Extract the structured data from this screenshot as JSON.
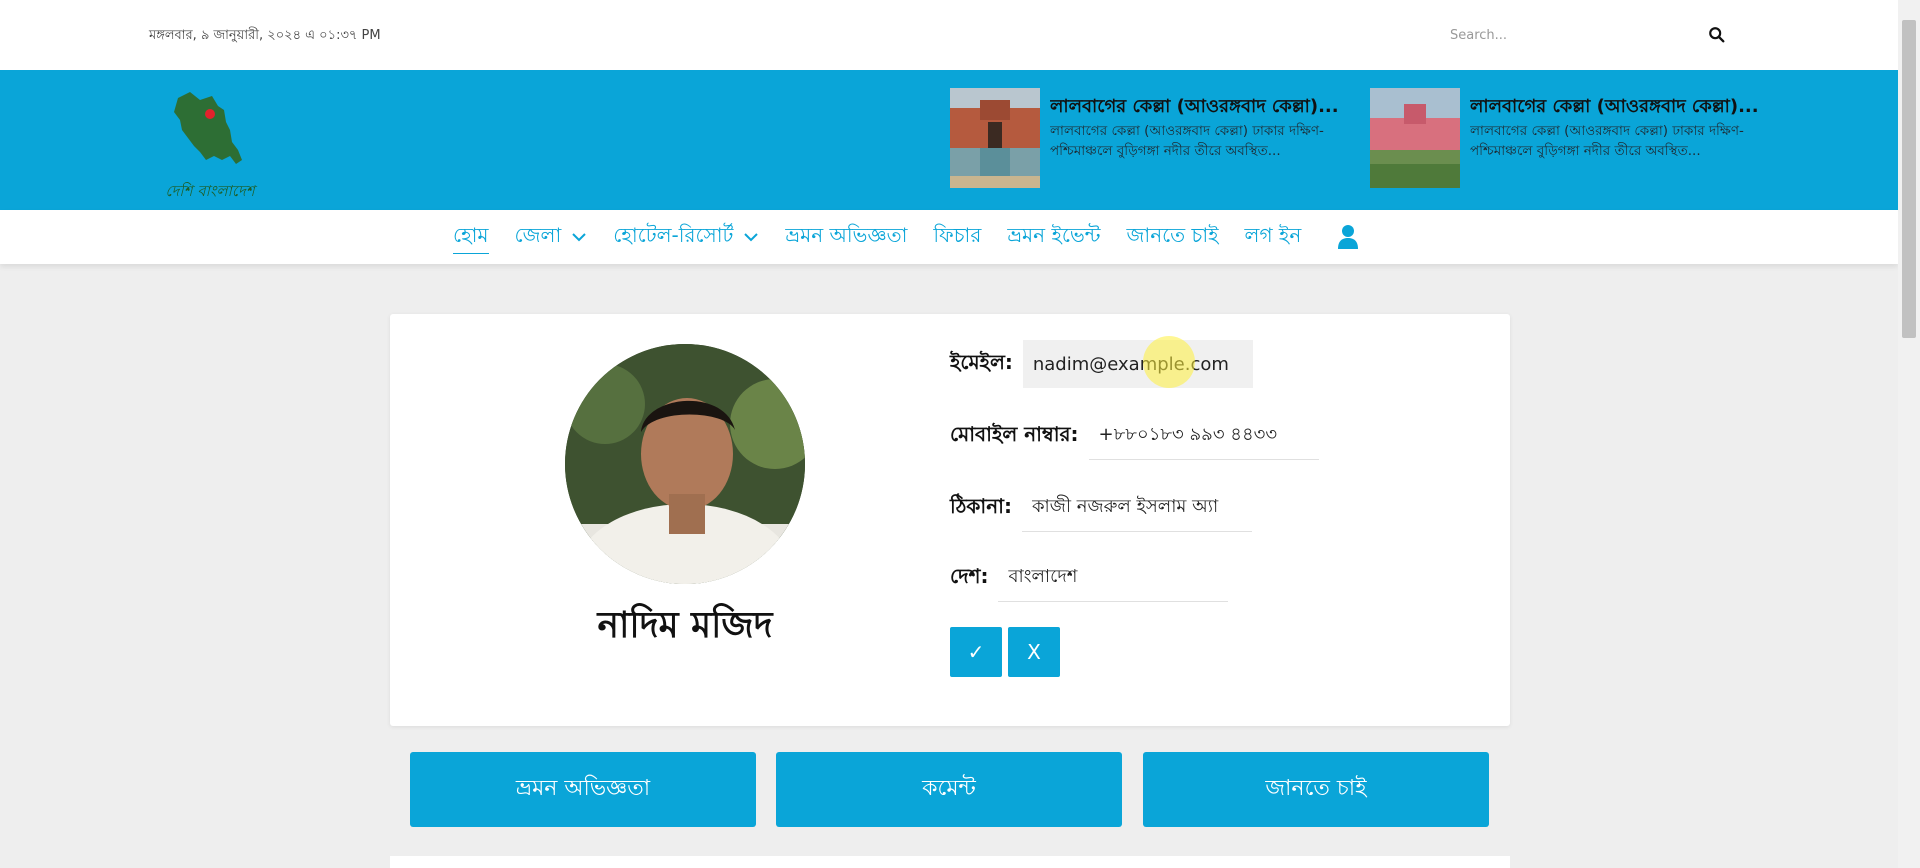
{
  "topbar": {
    "date": "মঙ্গলবার, ৯ জানুয়ারী, ২০২৪ এ ০১:৩৭ PM",
    "search_placeholder": "Search..."
  },
  "logo": {
    "text": "দেশি বাংলাদেশ"
  },
  "news": [
    {
      "title": "লালবাগের কেল্লা (আওরঙ্গবাদ কেল্লা)...",
      "desc": "লালবাগের কেল্লা (আওরঙ্গবাদ কেল্লা) ঢাকার দক্ষিণ-পশ্চিমাঞ্চলে বুড়িগঙ্গা নদীর তীরে অবস্থিত..."
    },
    {
      "title": "লালবাগের কেল্লা (আওরঙ্গবাদ কেল্লা)...",
      "desc": "লালবাগের কেল্লা (আওরঙ্গবাদ কেল্লা) ঢাকার দক্ষিণ-পশ্চিমাঞ্চলে বুড়িগঙ্গা নদীর তীরে অবস্থিত..."
    }
  ],
  "nav": {
    "home": "হোম",
    "district": "জেলা",
    "hotel": "হোটেল-রিসোর্ট",
    "travel": "ভ্রমন অভিজ্ঞতা",
    "feature": "ফিচার",
    "events": "ভ্রমন ইভেন্ট",
    "ask": "জানতে চাই",
    "login": "লগ ইন"
  },
  "profile": {
    "name": "নাদিম মজিদ",
    "email_label": "ইমেইল:",
    "email_value": "nadim@example.com",
    "mobile_label": "মোবাইল নাম্বার:",
    "mobile_value": "+৮৮০১৮৩ ৯৯৩ ৪৪৩৩",
    "address_label": "ঠিকানা:",
    "address_value": "কাজী নজরুল ইসলাম অ্যা",
    "country_label": "দেশ:",
    "country_value": "বাংলাদেশ",
    "confirm_label": "✓",
    "cancel_label": "X"
  },
  "actions": {
    "travel": "ভ্রমন অভিজ্ঞতা",
    "comment": "কমেন্ট",
    "ask": "জানতে চাই"
  },
  "colors": {
    "accent": "#0aa5d8",
    "background": "#eeeeee"
  }
}
